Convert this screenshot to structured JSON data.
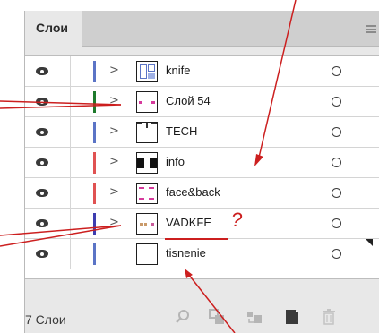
{
  "panel": {
    "tab_label": "Слои"
  },
  "layers": [
    {
      "name": "knife",
      "color": "#5b74c6",
      "has_children": true,
      "visible": true,
      "thumb": "knife"
    },
    {
      "name": "Слой 54",
      "color": "#1e7a2c",
      "has_children": true,
      "visible": true,
      "thumb": "dots"
    },
    {
      "name": "TECH",
      "color": "#5b74c6",
      "has_children": true,
      "visible": true,
      "thumb": "tech"
    },
    {
      "name": "info",
      "color": "#e05252",
      "has_children": true,
      "visible": true,
      "thumb": "info"
    },
    {
      "name": "face&back",
      "color": "#e05252",
      "has_children": true,
      "visible": true,
      "thumb": "face"
    },
    {
      "name": "VADKFE",
      "color": "#3d3db0",
      "has_children": true,
      "visible": true,
      "thumb": "vadkfe",
      "underlined": true
    },
    {
      "name": "tisnenie",
      "color": "#5b74c6",
      "has_children": false,
      "visible": true,
      "thumb": "blank"
    }
  ],
  "annotation": {
    "question_mark": "?",
    "color": "#cc1f1f"
  },
  "footer": {
    "count_label": "7 Слои",
    "icons": [
      "search-icon",
      "new-sublayer-icon",
      "move-selection-icon",
      "new-layer-icon",
      "trash-icon"
    ]
  }
}
